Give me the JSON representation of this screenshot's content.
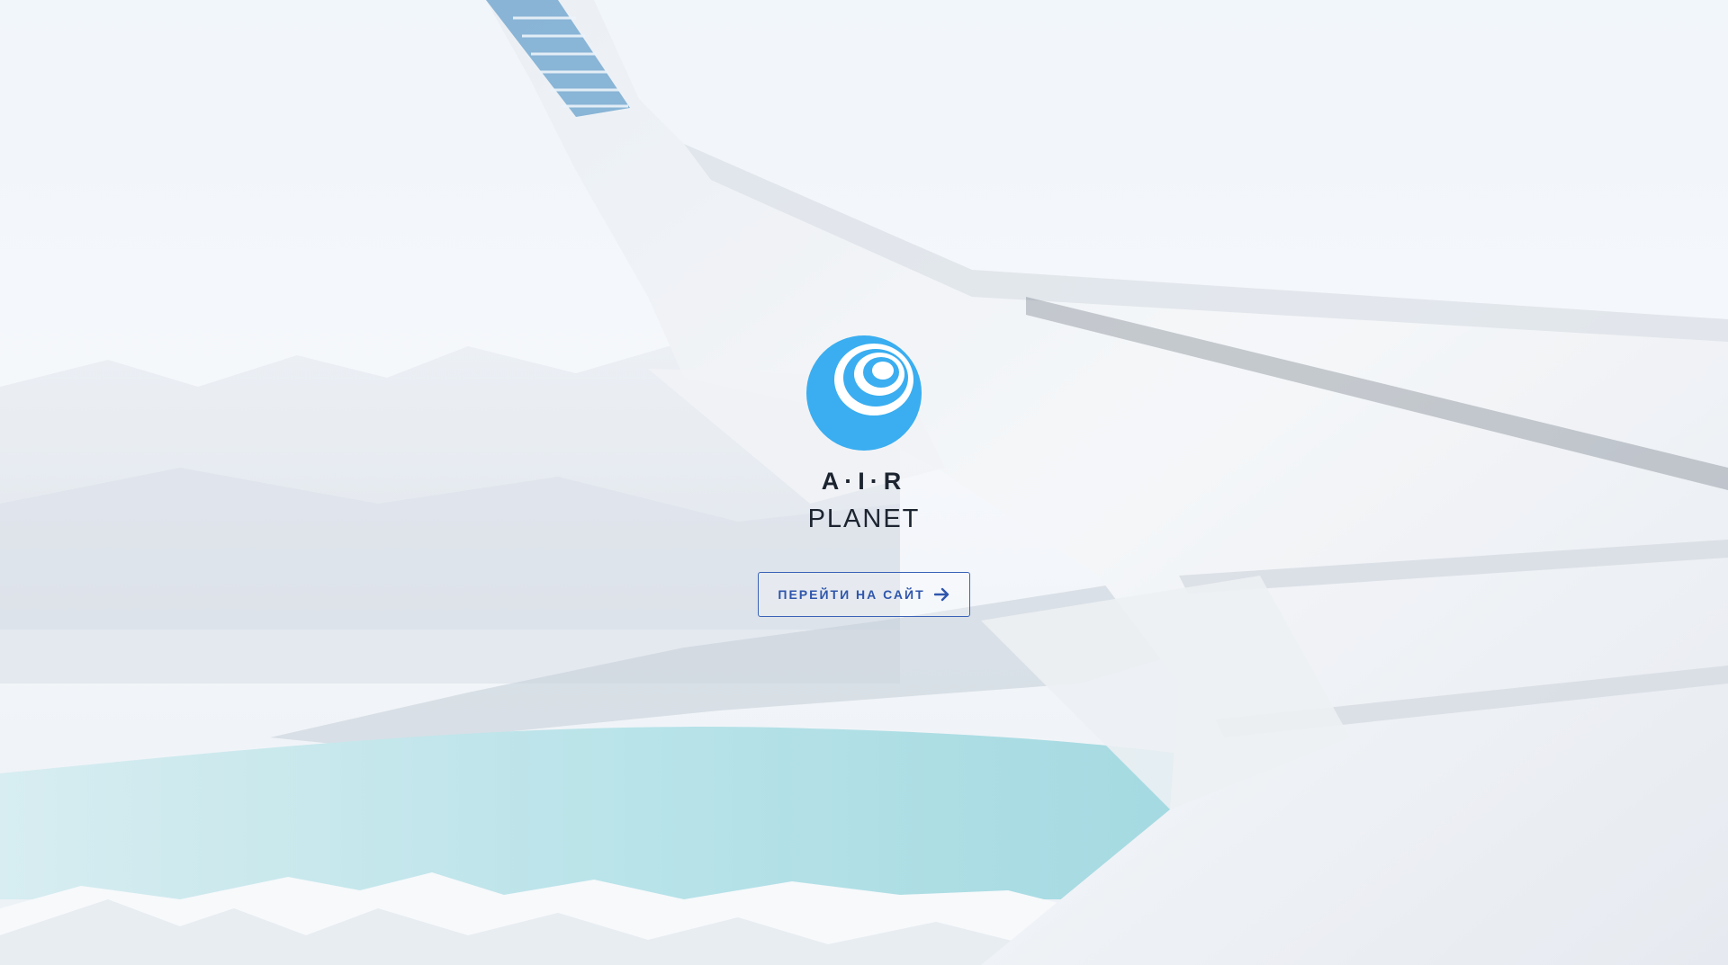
{
  "brand": {
    "name_top": "A·I·R",
    "name_bottom": "PLANET",
    "logo_icon": "globe-rings-icon"
  },
  "cta": {
    "label": "ПЕРЕЙТИ НА САЙТ",
    "icon": "arrow-right-icon"
  },
  "colors": {
    "accent": "#3aaef0",
    "button_border": "#3a63b8",
    "button_text": "#2f56ad",
    "brand_text": "#1c2430"
  }
}
